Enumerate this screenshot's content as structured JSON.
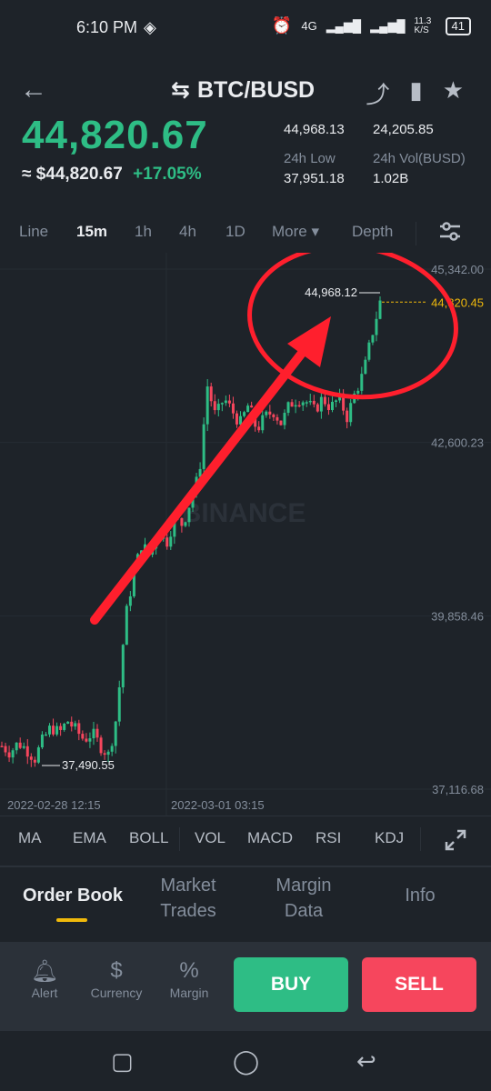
{
  "status_bar": {
    "time": "6:10 PM",
    "net": "4G",
    "speed": "11.3 K/S",
    "battery": "41"
  },
  "header": {
    "pair": "BTC/BUSD"
  },
  "ticker": {
    "last_price": "44,820.67",
    "fiat_price": "≈ $44,820.67",
    "change_pct": "+17.05%",
    "high_value": "44,968.13",
    "vol_btc": "24,205.85",
    "low_label": "24h Low",
    "low_value": "37,951.18",
    "vol_busd_label": "24h Vol(BUSD)",
    "vol_busd_value": "1.02B"
  },
  "timeframes": {
    "line": "Line",
    "m15": "15m",
    "h1": "1h",
    "h4": "4h",
    "d1": "1D",
    "more": "More ▾",
    "depth": "Depth"
  },
  "chart": {
    "y_ticks": [
      "45,342.00",
      "42,600.23",
      "39,858.46",
      "37,116.68"
    ],
    "x_ticks": [
      "2022-02-28 12:15",
      "2022-03-01 03:15"
    ],
    "high_marker": "44,968.12",
    "low_marker": "37,490.55",
    "last_marker": "44,820.45",
    "watermark": "BINANCE",
    "colors": {
      "up": "#2ebd85",
      "down": "#f6465d",
      "annotation": "#ff1f2d",
      "last": "#f0b90b"
    }
  },
  "chart_data": {
    "type": "candlestick",
    "interval": "15m",
    "ylim": [
      37116.68,
      45342.0
    ],
    "y_ticks": [
      45342.0,
      42600.23,
      39858.46,
      37116.68
    ],
    "x_ticks": [
      "2022-02-28 12:15",
      "2022-03-01 03:15"
    ],
    "close_trace": [
      37800,
      37700,
      37850,
      37750,
      37600,
      37900,
      38100,
      38000,
      38200,
      38050,
      37900,
      38000,
      37800,
      37650,
      38300,
      39800,
      40500,
      41000,
      40800,
      41200,
      41000,
      41400,
      41300,
      41700,
      42100,
      43500,
      43000,
      43300,
      43100,
      42900,
      43200,
      42800,
      43000,
      43100,
      42900,
      43200,
      43300,
      43250,
      43100,
      43300,
      43150,
      43300,
      43000,
      43400,
      43700,
      44300,
      44820
    ],
    "high": 44968.12,
    "low": 37490.55,
    "last": 44820.45
  },
  "indicators": [
    "MA",
    "EMA",
    "BOLL",
    "VOL",
    "MACD",
    "RSI",
    "KDJ"
  ],
  "tabs": {
    "order_book": "Order Book",
    "market_trades": "Market Trades",
    "margin_data": "Margin Data",
    "info": "Info"
  },
  "actions": {
    "alert": "Alert",
    "currency": "Currency",
    "margin": "Margin",
    "buy": "BUY",
    "sell": "SELL"
  }
}
